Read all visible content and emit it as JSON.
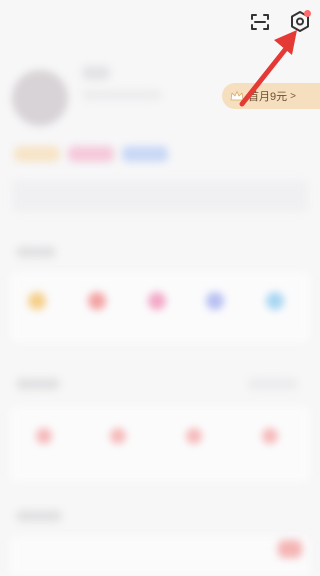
{
  "toolbar": {
    "scan_icon": "scan-icon",
    "settings_icon": "settings-icon"
  },
  "vip": {
    "label": "首月9元",
    "chevron": ">"
  },
  "colors": {
    "background": "#f7f7f8",
    "arrow": "#e53935",
    "vip_bg": "#f6dfbf",
    "badge": "#ff6b6b"
  }
}
